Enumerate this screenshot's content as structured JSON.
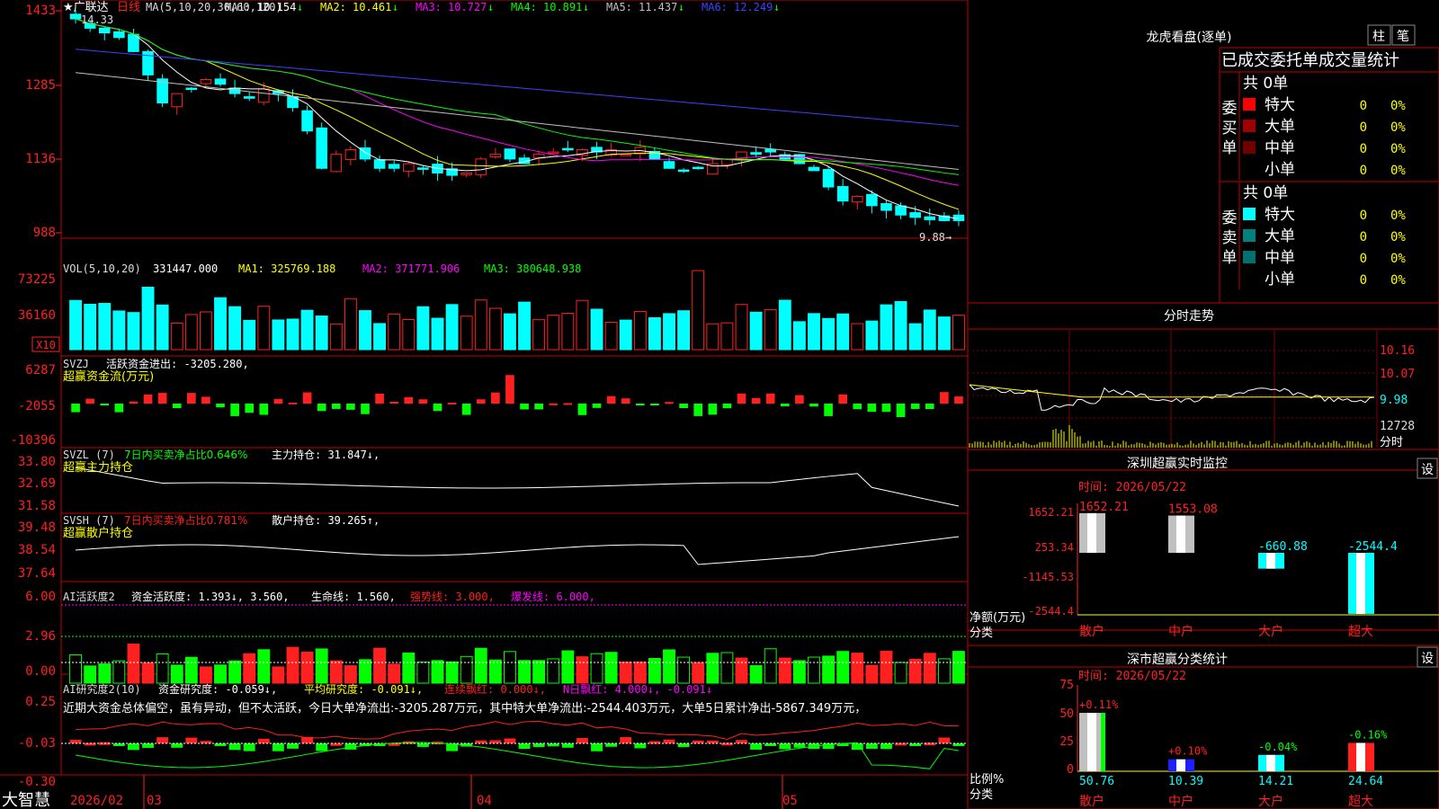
{
  "stock": {
    "star": "★",
    "name": "广联达",
    "period": "日线",
    "last_price_label": "9.88→",
    "high_label": "14.33"
  },
  "brand": "大智慧",
  "main_chart": {
    "ma_header": "MA(5,10,20,30,60,120)",
    "ma_values": [
      {
        "label": "MA1:",
        "value": "10.154",
        "arrow": "↓",
        "color": "#ffffff"
      },
      {
        "label": "MA2:",
        "value": "10.461",
        "arrow": "↓",
        "color": "#ffff00"
      },
      {
        "label": "MA3:",
        "value": "10.727",
        "arrow": "↓",
        "color": "#ff00ff"
      },
      {
        "label": "MA4:",
        "value": "10.891",
        "arrow": "↓",
        "color": "#00ff00"
      },
      {
        "label": "MA5:",
        "value": "11.437",
        "arrow": "↓",
        "color": "#c0c0c0"
      },
      {
        "label": "MA6:",
        "value": "12.249",
        "arrow": "↓",
        "color": "#4040ff"
      }
    ],
    "y_ticks": [
      "1433",
      "1285",
      "1136",
      "988"
    ],
    "x_labels": [
      "2026/02",
      "03",
      "04",
      "05"
    ]
  },
  "vol_panel": {
    "header": "VOL(5,10,20)",
    "value": "331447.000",
    "ma1": "325769.188",
    "ma2": "371771.906",
    "ma3": "380648.938",
    "y_ticks": [
      "73225",
      "36160"
    ],
    "unit": "X10"
  },
  "svzj_panel": {
    "header": "SVZJ",
    "title": "活跃资金进出:",
    "value": "-3205.280",
    "sub": "超赢资金流(万元)",
    "y_ticks": [
      "6287",
      "-2055",
      "-10396"
    ]
  },
  "svzl_panel": {
    "header": "SVZL (7)",
    "ratio_label": "7日内买卖净占比0.646%",
    "hold_label": "主力持仓:",
    "hold_value": "31.847",
    "sub": "超赢主力持仓",
    "y_ticks": [
      "33.80",
      "32.69",
      "31.58"
    ]
  },
  "svsh_panel": {
    "header": "SVSH (7)",
    "ratio_label": "7日内买卖净占比0.781%",
    "hold_label": "散户持仓:",
    "hold_value": "39.265",
    "sub": "超赢散户持仓",
    "y_ticks": [
      "39.48",
      "38.54",
      "37.64"
    ]
  },
  "ai_active_panel": {
    "header": "AI活跃度2",
    "label1": "资金活跃度:",
    "v1": "1.393",
    "v2": "3.560",
    "life_label": "生命线:",
    "life": "1.560",
    "strong_label": "强势线:",
    "strong": "3.000",
    "burst_label": "爆发线:",
    "burst": "6.000",
    "y_ticks": [
      "6.00",
      "2.96",
      "0.00"
    ]
  },
  "ai_research_panel": {
    "header": "AI研究度2(10)",
    "label1": "资金研究度:",
    "v1": "-0.059",
    "avg_label": "平均研究度:",
    "avg": "-0.091",
    "cont_label": "连续飘红:",
    "cont": "0.000",
    "nday_label": "N日飘红:",
    "nday": "4.000",
    "extra": "-0.091",
    "y_ticks": [
      "0.25",
      "-0.03",
      "-0.30"
    ],
    "comment": "近期大资金总体偏空，虽有异动，但不太活跃，今日大单净流出:-3205.287万元，其中特大单净流出:-2544.403万元，大单5日累计净出-5867.349万元，"
  },
  "right": {
    "tabs": [
      "柱",
      "笔"
    ],
    "longhu_title": "龙虎看盘(逐单)",
    "stats_title": "已成交委托单成交量统计",
    "buy_side": {
      "label": "委买单",
      "total": "共 0单",
      "rows": [
        {
          "name": "特大",
          "count": "0",
          "pct": "0%",
          "color": "#ff0000"
        },
        {
          "name": "大单",
          "count": "0",
          "pct": "0%",
          "color": "#a00000"
        },
        {
          "name": "中单",
          "count": "0",
          "pct": "0%",
          "color": "#700000"
        },
        {
          "name": "小单",
          "count": "0",
          "pct": "0%",
          "color": ""
        }
      ]
    },
    "sell_side": {
      "label": "委卖单",
      "total": "共 0单",
      "rows": [
        {
          "name": "特大",
          "count": "0",
          "pct": "0%",
          "color": "#00ffff"
        },
        {
          "name": "大单",
          "count": "0",
          "pct": "0%",
          "color": "#008080"
        },
        {
          "name": "中单",
          "count": "0",
          "pct": "0%",
          "color": "#007070"
        },
        {
          "name": "小单",
          "count": "0",
          "pct": "0%",
          "color": ""
        }
      ]
    },
    "fenshi": {
      "title": "分时走势",
      "y_ticks": [
        "10.16",
        "10.07",
        "9.98",
        "12728"
      ],
      "unit": "分时"
    },
    "monitor": {
      "title": "深圳超赢实时监控",
      "set": "设",
      "time": "时间: 2026/05/22",
      "y_ticks": [
        "1652.21",
        "253.34",
        "-1145.53",
        "-2544.4"
      ],
      "unit": "净额(万元)",
      "axis_label": "分类",
      "categories": [
        "散户",
        "中户",
        "大户",
        "超大"
      ],
      "values": [
        1652.21,
        1553.08,
        -660.88,
        -2544.4
      ],
      "value_labels": [
        "1652.21",
        "1553.08",
        "-660.88",
        "-2544.4"
      ]
    },
    "classify": {
      "title": "深市超赢分类统计",
      "set": "设",
      "time": "时间: 2026/05/22",
      "y_ticks": [
        "75",
        "50",
        "25",
        "0"
      ],
      "unit": "比例%",
      "axis_label": "分类",
      "categories": [
        "散户",
        "中户",
        "大户",
        "超大"
      ],
      "values": [
        50.76,
        10.39,
        14.21,
        24.64
      ],
      "changes": [
        "+0.11%",
        "+0.10%",
        "-0.04%",
        "-0.16%"
      ],
      "value_labels": [
        "50.76",
        "10.39",
        "14.21",
        "24.64"
      ]
    }
  },
  "colors": {
    "up": "#ff2020",
    "down": "#00ffff",
    "border": "#c00000",
    "grid": "#800000",
    "yellow": "#ffff00",
    "green": "#00ff00",
    "magenta": "#ff00ff"
  }
}
